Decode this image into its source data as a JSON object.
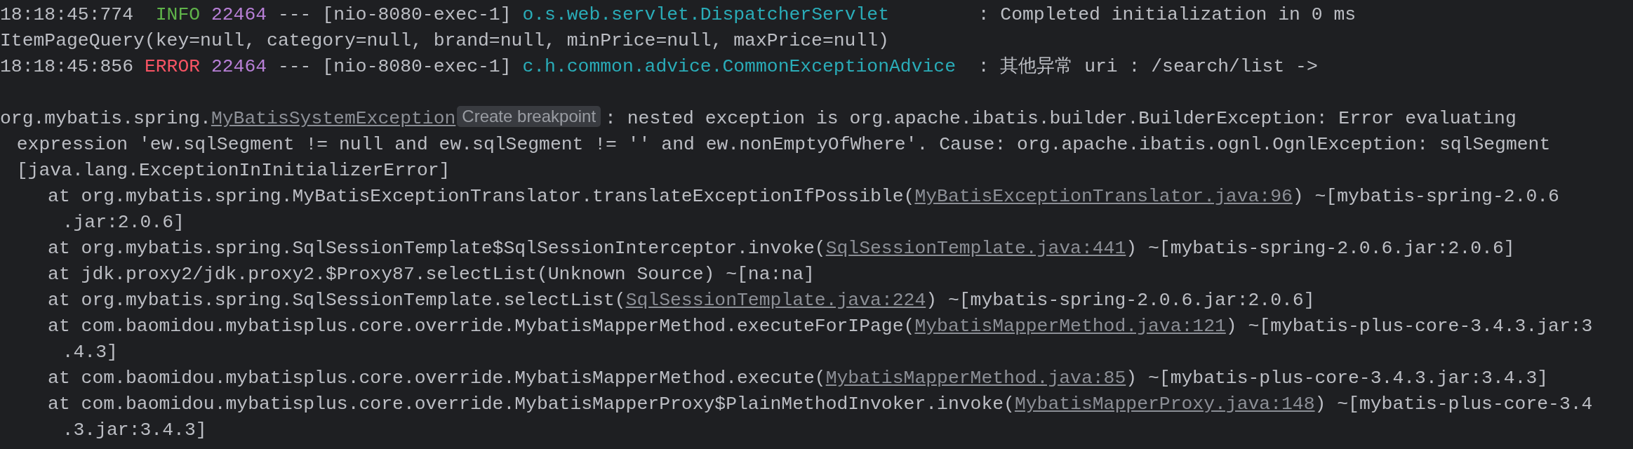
{
  "console": {
    "lines": [
      {
        "kind": "log",
        "time": "18:18:45:774",
        "level": "INFO",
        "color": "#5fb34a",
        "pid": "22464",
        "separator": "---",
        "thread": "[nio-8080-exec-1]",
        "logger": "o.s.web.servlet.DispatcherServlet",
        "message": ": Completed initialization in 0 ms"
      },
      {
        "kind": "plain",
        "parts": [
          {
            "kind": "text",
            "text": "ItemPageQuery(key=null, category=null, brand=null, minPrice=null, maxPrice=null)"
          }
        ]
      },
      {
        "kind": "log",
        "time": "18:18:45:856",
        "level": "ERROR",
        "color": "#f75464",
        "pid": "22464",
        "separator": "---",
        "thread": "[nio-8080-exec-1]",
        "logger": "c.h.common.advice.CommonExceptionAdvice",
        "message": ": 其他异常 uri : /search/list ->"
      },
      {
        "kind": "blank"
      },
      {
        "kind": "plain",
        "parts": [
          {
            "kind": "text",
            "text": "org.mybatis.spring."
          },
          {
            "kind": "link",
            "text": "MyBatisSystemException"
          },
          {
            "kind": "hint",
            "text": "Create breakpoint"
          },
          {
            "kind": "text",
            "text": ": nested exception is org.apache.ibatis.builder.BuilderException: Error evaluating"
          }
        ]
      },
      {
        "kind": "wrap",
        "parts": [
          {
            "kind": "text",
            "text": "expression 'ew.sqlSegment != null and ew.sqlSegment != '' and ew.nonEmptyOfWhere'. Cause: org.apache.ibatis.ognl.OgnlException: sqlSegment"
          }
        ]
      },
      {
        "kind": "wrap",
        "parts": [
          {
            "kind": "text",
            "text": "[java.lang.ExceptionInInitializerError]"
          }
        ]
      },
      {
        "kind": "frame",
        "parts": [
          {
            "kind": "text",
            "text": "at org.mybatis.spring.MyBatisExceptionTranslator.translateExceptionIfPossible("
          },
          {
            "kind": "link",
            "text": "MyBatisExceptionTranslator.java:96"
          },
          {
            "kind": "text",
            "text": ") ~[mybatis-spring-2.0.6"
          }
        ]
      },
      {
        "kind": "frame-wrap",
        "parts": [
          {
            "kind": "text",
            "text": ".jar:2.0.6]"
          }
        ]
      },
      {
        "kind": "frame",
        "parts": [
          {
            "kind": "text",
            "text": "at org.mybatis.spring.SqlSessionTemplate$SqlSessionInterceptor.invoke("
          },
          {
            "kind": "link",
            "text": "SqlSessionTemplate.java:441"
          },
          {
            "kind": "text",
            "text": ") ~[mybatis-spring-2.0.6.jar:2.0.6]"
          }
        ]
      },
      {
        "kind": "frame",
        "parts": [
          {
            "kind": "text",
            "text": "at jdk.proxy2/jdk.proxy2.$Proxy87.selectList(Unknown Source) ~[na:na]"
          }
        ]
      },
      {
        "kind": "frame",
        "parts": [
          {
            "kind": "text",
            "text": "at org.mybatis.spring.SqlSessionTemplate.selectList("
          },
          {
            "kind": "link",
            "text": "SqlSessionTemplate.java:224"
          },
          {
            "kind": "text",
            "text": ") ~[mybatis-spring-2.0.6.jar:2.0.6]"
          }
        ]
      },
      {
        "kind": "frame",
        "parts": [
          {
            "kind": "text",
            "text": "at com.baomidou.mybatisplus.core.override.MybatisMapperMethod.executeForIPage("
          },
          {
            "kind": "link",
            "text": "MybatisMapperMethod.java:121"
          },
          {
            "kind": "text",
            "text": ") ~[mybatis-plus-core-3.4.3.jar:3"
          }
        ]
      },
      {
        "kind": "frame-wrap",
        "parts": [
          {
            "kind": "text",
            "text": ".4.3]"
          }
        ]
      },
      {
        "kind": "frame",
        "parts": [
          {
            "kind": "text",
            "text": "at com.baomidou.mybatisplus.core.override.MybatisMapperMethod.execute("
          },
          {
            "kind": "link",
            "text": "MybatisMapperMethod.java:85"
          },
          {
            "kind": "text",
            "text": ") ~[mybatis-plus-core-3.4.3.jar:3.4.3]"
          }
        ]
      },
      {
        "kind": "frame",
        "parts": [
          {
            "kind": "text",
            "text": "at com.baomidou.mybatisplus.core.override.MybatisMapperProxy$PlainMethodInvoker.invoke("
          },
          {
            "kind": "link",
            "text": "MybatisMapperProxy.java:148"
          },
          {
            "kind": "text",
            "text": ") ~[mybatis-plus-core-3.4"
          }
        ]
      },
      {
        "kind": "frame-wrap",
        "parts": [
          {
            "kind": "text",
            "text": ".3.jar:3.4.3]"
          }
        ]
      }
    ]
  }
}
